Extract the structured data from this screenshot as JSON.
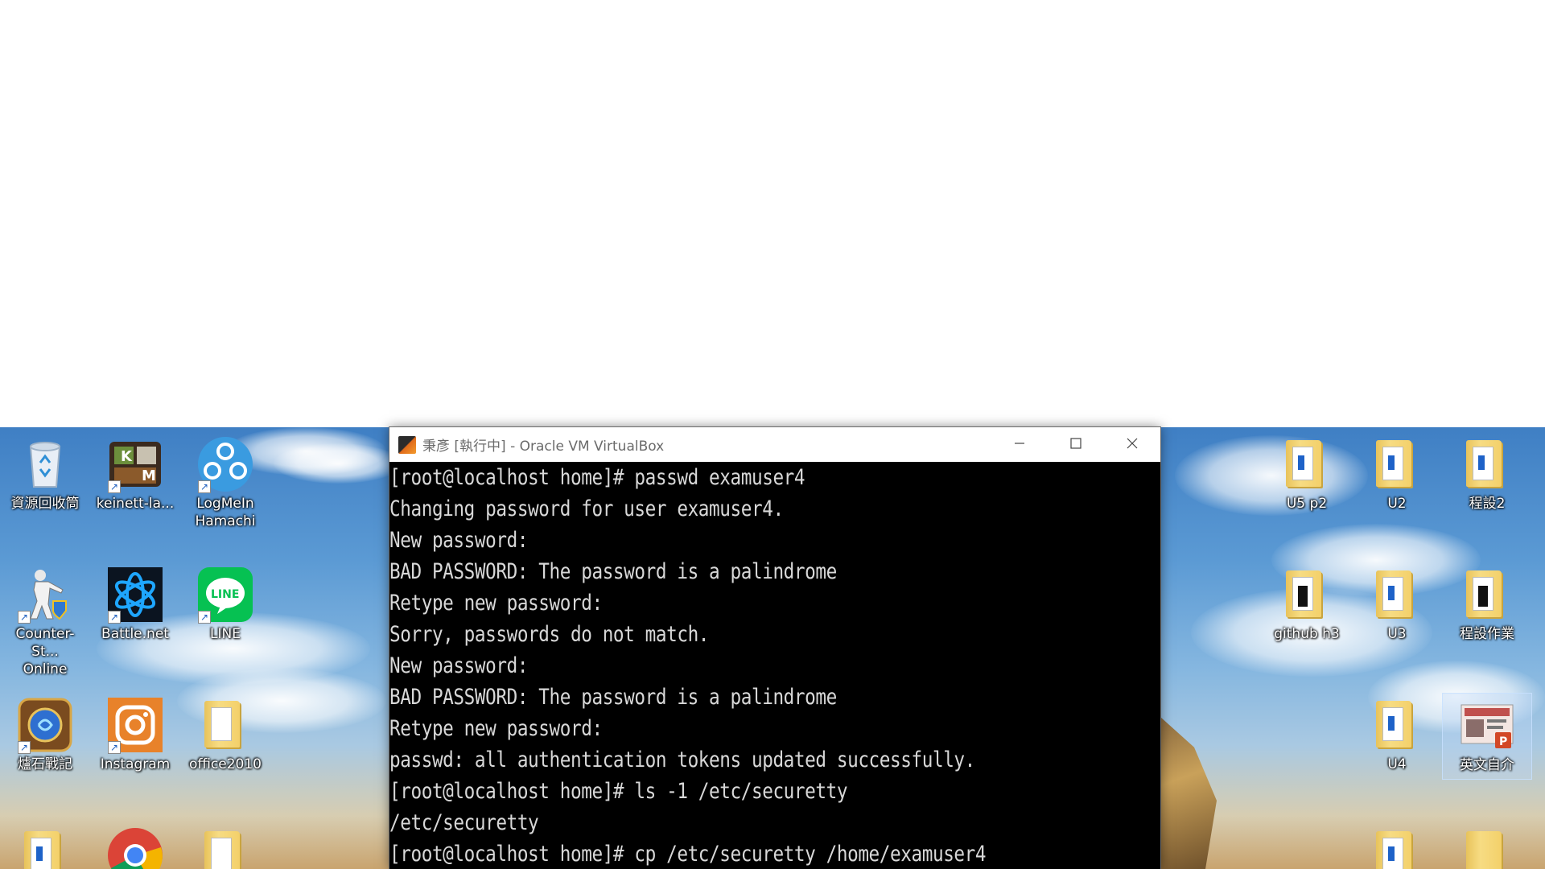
{
  "window": {
    "title": "秉彥 [執行中] - Oracle VM VirtualBox",
    "minimize_icon": "minimize-icon",
    "maximize_icon": "maximize-icon",
    "close_icon": "close-icon"
  },
  "terminal": {
    "lines": [
      "[root@localhost home]# passwd examuser4",
      "Changing password for user examuser4.",
      "New password:",
      "BAD PASSWORD: The password is a palindrome",
      "Retype new password:",
      "Sorry, passwords do not match.",
      "New password:",
      "BAD PASSWORD: The password is a palindrome",
      "Retype new password:",
      "passwd: all authentication tokens updated successfully.",
      "[root@localhost home]# ls -1 /etc/securetty",
      "/etc/securetty",
      "[root@localhost home]# cp /etc/securetty /home/examuser4"
    ]
  },
  "desktop": {
    "left_icons": [
      {
        "label": "資源回收筒",
        "icon": "recycle-bin-icon"
      },
      {
        "label": "keinett-la...",
        "icon": "keinett-app-icon"
      },
      {
        "label": "LogMeIn\nHamachi",
        "icon": "hamachi-icon"
      },
      {
        "label": "Counter-St...\nOnline",
        "icon": "counter-strike-icon"
      },
      {
        "label": "Battle.net",
        "icon": "battlenet-icon"
      },
      {
        "label": "LINE",
        "icon": "line-icon"
      },
      {
        "label": "爐石戰記",
        "icon": "hearthstone-icon"
      },
      {
        "label": "Instagram",
        "icon": "instagram-icon"
      },
      {
        "label": "office2010",
        "icon": "folder-icon"
      }
    ],
    "right_icons": [
      {
        "label": "U5 p2",
        "icon": "folder-icon"
      },
      {
        "label": "U2",
        "icon": "folder-icon"
      },
      {
        "label": "程設2",
        "icon": "folder-icon"
      },
      {
        "label": "github h3",
        "icon": "folder-icon"
      },
      {
        "label": "U3",
        "icon": "folder-icon"
      },
      {
        "label": "程設作業",
        "icon": "folder-icon"
      },
      {
        "label": "U4",
        "icon": "folder-icon"
      },
      {
        "label": "英文自介",
        "icon": "powerpoint-file-icon"
      }
    ]
  },
  "colors": {
    "terminal_bg": "#000000",
    "terminal_fg": "#d8d8d8",
    "titlebar_bg": "#ffffff",
    "title_text": "#6b6b6b"
  }
}
